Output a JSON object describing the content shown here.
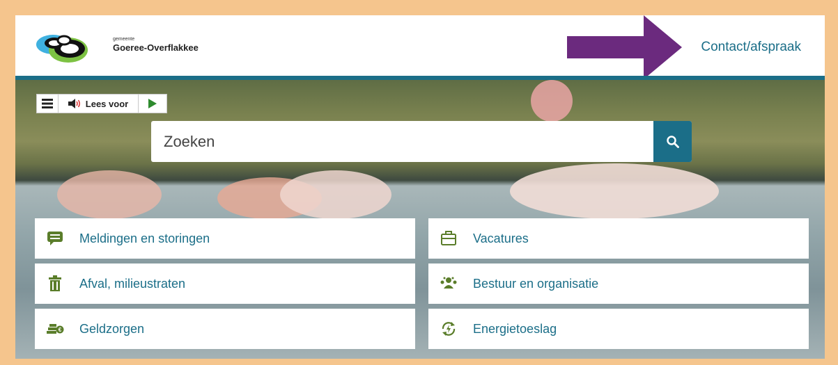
{
  "header": {
    "logo_small": "gemeente",
    "logo_big": "Goeree-Overflakkee",
    "contact_link": "Contact/afspraak"
  },
  "toolbar": {
    "menu_icon": "hamburger-icon",
    "read_label": "Lees voor",
    "play_icon": "play-icon"
  },
  "search": {
    "placeholder": "Zoeken",
    "button_icon": "search-icon"
  },
  "tiles": [
    {
      "label": "Meldingen en storingen",
      "icon": "speech-bubble-icon"
    },
    {
      "label": "Vacatures",
      "icon": "briefcase-icon"
    },
    {
      "label": "Afval, milieustraten",
      "icon": "trash-bin-icon"
    },
    {
      "label": "Bestuur en organisatie",
      "icon": "people-group-icon"
    },
    {
      "label": "Geldzorgen",
      "icon": "coins-icon"
    },
    {
      "label": "Energietoeslag",
      "icon": "energy-cycle-icon"
    }
  ],
  "colors": {
    "frame": "#f5c58d",
    "accent": "#1b6e88",
    "icon_green": "#5a7d2a",
    "arrow": "#6b2a7e"
  }
}
